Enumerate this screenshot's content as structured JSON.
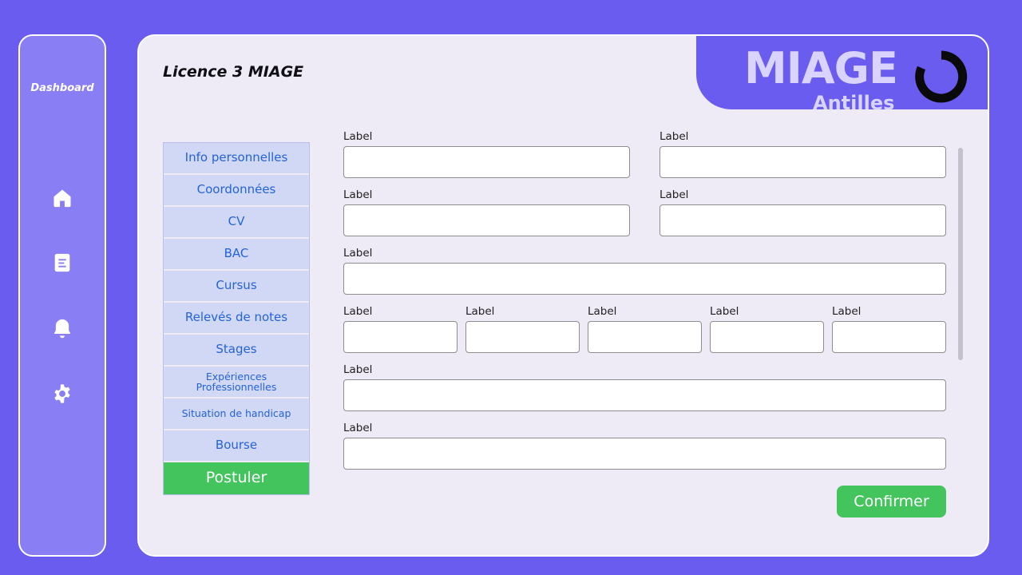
{
  "sidebar": {
    "title": "Dashboard",
    "icons": [
      "home-icon",
      "document-icon",
      "bell-icon",
      "gear-icon"
    ]
  },
  "header": {
    "title": "Licence 3 MIAGE",
    "logo": {
      "line1": "MIAGE",
      "line2": "Antilles"
    }
  },
  "tabs": [
    "Info personnelles",
    "Coordonnées",
    "CV",
    "BAC",
    "Cursus",
    "Relevés de notes",
    "Stages",
    "Expériences Professionnelles",
    "Situation de handicap",
    "Bourse",
    "Postuler"
  ],
  "form": {
    "labels": [
      "Label",
      "Label",
      "Label",
      "Label",
      "Label",
      "Label",
      "Label",
      "Label",
      "Label",
      "Label",
      "Label",
      "Label"
    ],
    "confirm_label": "Confirmer"
  },
  "colors": {
    "background": "#6b5cf0",
    "panel": "#eeeaf6",
    "tab": "#d0d8f6",
    "tab_text": "#2563d8",
    "accent_green": "#43c45d"
  }
}
